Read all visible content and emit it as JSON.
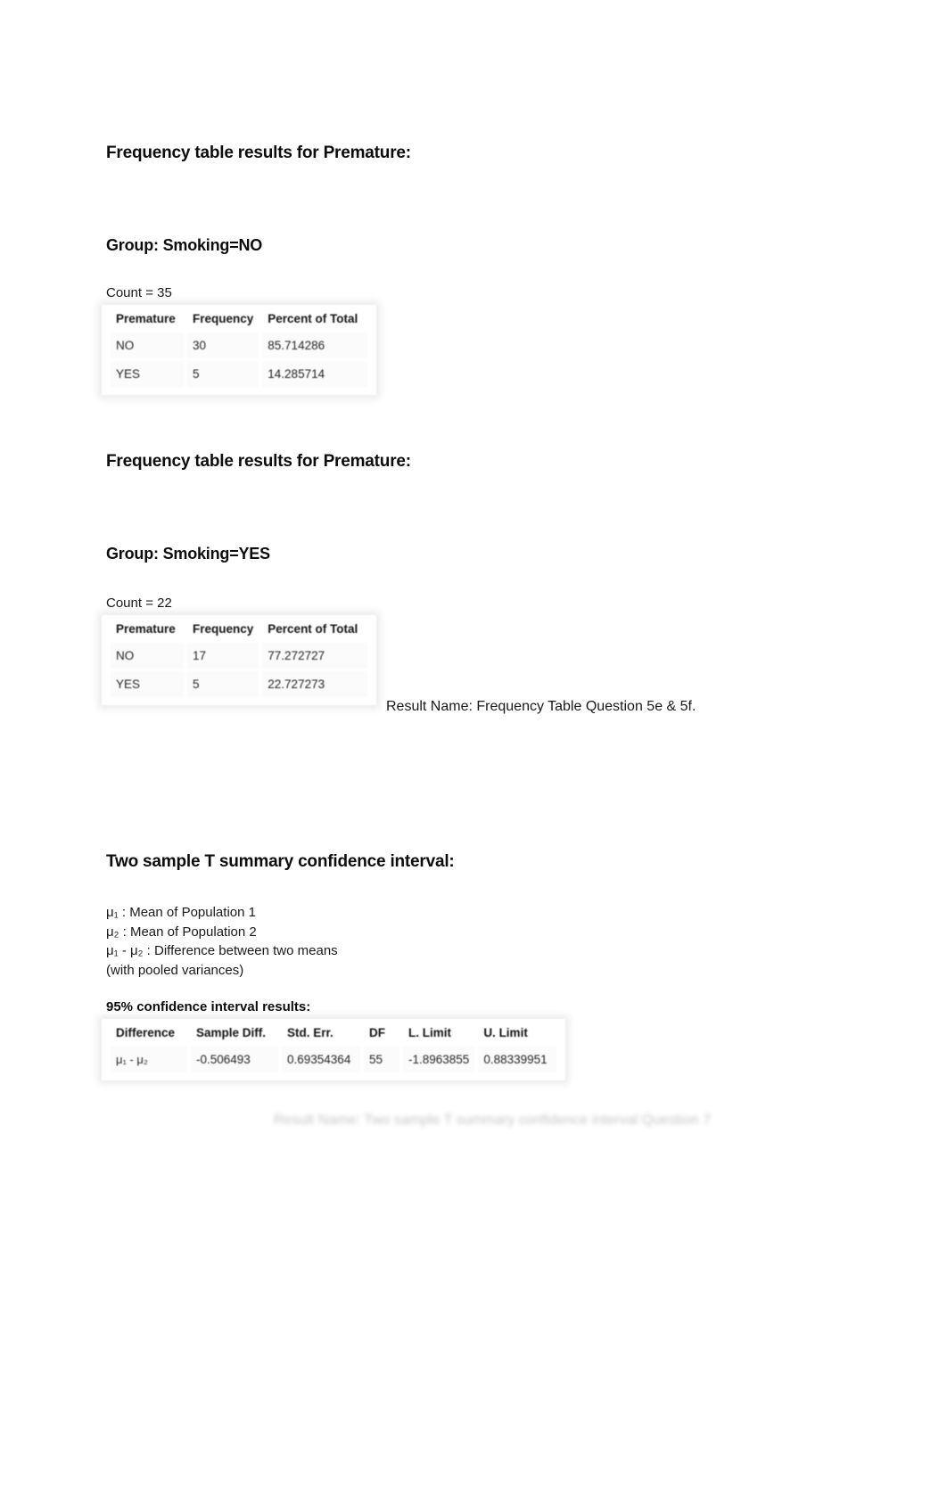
{
  "document": {
    "background_color": "#ffffff",
    "text_color": "#1a1a1a"
  },
  "section_no": {
    "heading": "Frequency table results for Premature:",
    "group": "Group: Smoking=NO",
    "count": "Count = 35",
    "table": {
      "columns": [
        "Premature",
        "Frequency",
        "Percent of Total"
      ],
      "rows": [
        [
          "NO",
          "30",
          "85.714286"
        ],
        [
          "YES",
          "5",
          "14.285714"
        ]
      ]
    }
  },
  "section_yes": {
    "heading": "Frequency table results for Premature:",
    "group": "Group: Smoking=YES",
    "count": "Count = 22",
    "table": {
      "columns": [
        "Premature",
        "Frequency",
        "Percent of Total"
      ],
      "rows": [
        [
          "NO",
          "17",
          "77.272727"
        ],
        [
          "YES",
          "5",
          "22.727273"
        ]
      ]
    }
  },
  "result_name_frequency": "Result Name: Frequency Table Question 5e & 5f.",
  "section_ttest": {
    "heading": "Two sample T summary confidence interval:",
    "definitions": [
      "μ₁ : Mean of Population 1",
      "μ₂ : Mean of Population 2",
      "μ₁ - μ₂ : Difference between two means",
      "(with pooled variances)"
    ],
    "ci_label": "95% confidence interval results:",
    "table": {
      "columns": [
        "Difference",
        "Sample Diff.",
        "Std. Err.",
        "DF",
        "L. Limit",
        "U. Limit"
      ],
      "rows": [
        [
          "μ₁ - μ₂",
          "-0.506493",
          "0.69354364",
          "55",
          "-1.8963855",
          "0.88339951"
        ]
      ]
    }
  },
  "result_name_ttest": "Result Name: Two sample T summary confidence interval Question 7"
}
